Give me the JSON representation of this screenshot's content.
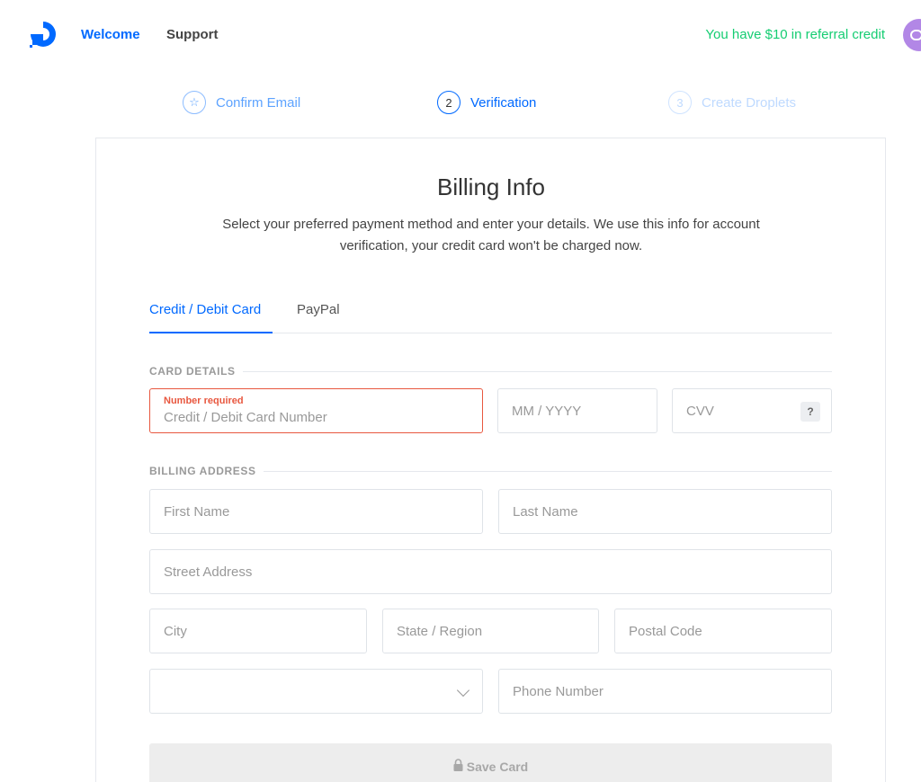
{
  "header": {
    "nav": {
      "welcome": "Welcome",
      "support": "Support"
    },
    "referral_text": "You have $10 in referral credit"
  },
  "steps": [
    {
      "number": "☆",
      "label": "Confirm Email",
      "state": "done"
    },
    {
      "number": "2",
      "label": "Verification",
      "state": "active"
    },
    {
      "number": "3",
      "label": "Create Droplets",
      "state": "upcoming"
    }
  ],
  "billing": {
    "title": "Billing Info",
    "subtitle_line1": "Select your preferred payment method and enter your details. We use this info for account",
    "subtitle_line2": "verification, your credit card won't be charged now."
  },
  "tabs": {
    "card": "Credit / Debit Card",
    "paypal": "PayPal"
  },
  "card_details": {
    "section_label": "CARD DETAILS",
    "number_error": "Number required",
    "number_placeholder": "Credit / Debit Card Number",
    "expiry_placeholder": "MM / YYYY",
    "cvv_placeholder": "CVV",
    "cvv_help": "?"
  },
  "billing_address": {
    "section_label": "BILLING ADDRESS",
    "first_name": "First Name",
    "last_name": "Last Name",
    "street": "Street Address",
    "city": "City",
    "state": "State / Region",
    "postal": "Postal Code",
    "country_value": "",
    "phone": "Phone Number"
  },
  "save_button": "Save Card",
  "colors": {
    "accent": "#0069ff",
    "referral": "#15cd72",
    "error": "#e8573f"
  }
}
